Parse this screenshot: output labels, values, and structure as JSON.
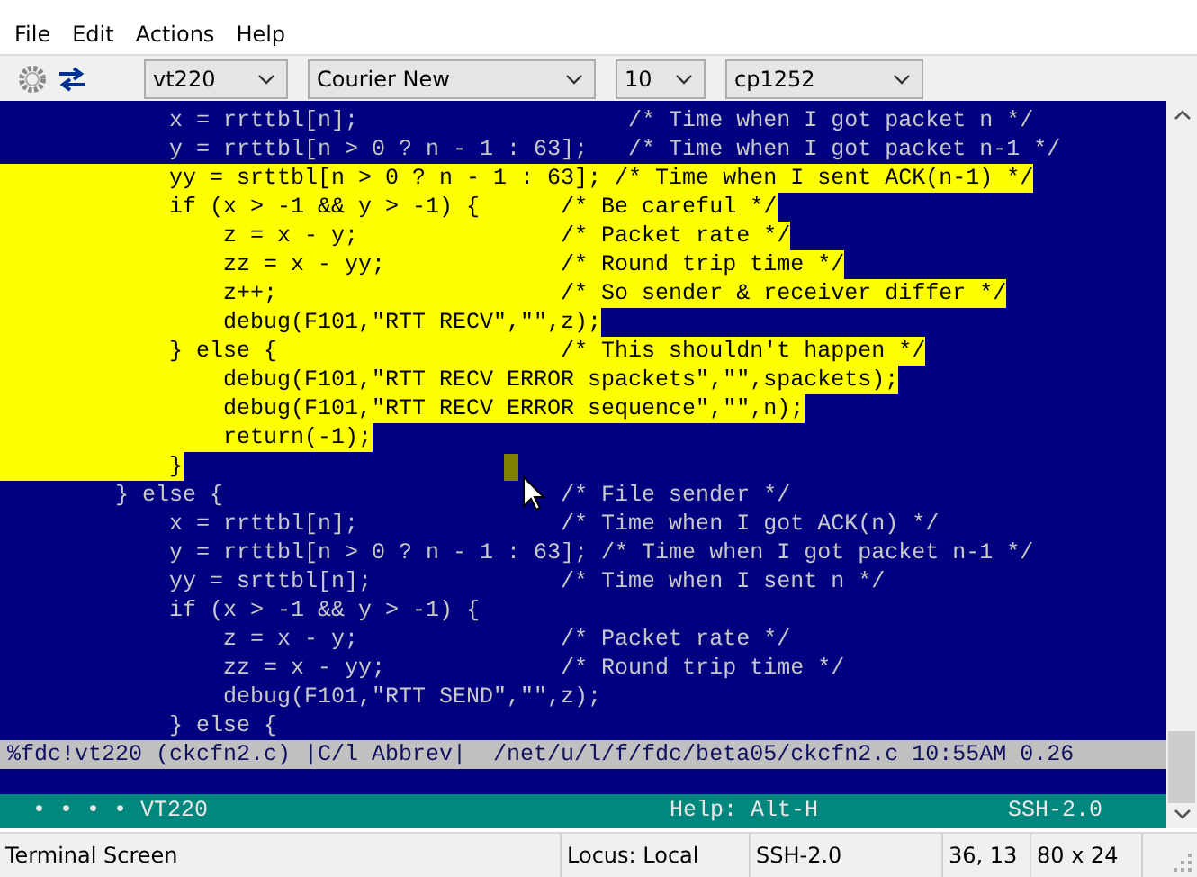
{
  "menu": [
    "File",
    "Edit",
    "Actions",
    "Help"
  ],
  "toolbar": {
    "terminal_type": "vt220",
    "font": "Courier New",
    "font_size": "10",
    "charset": "cp1252"
  },
  "terminal": {
    "lines": [
      {
        "text": "            x = rrttbl[n];                    /* Time when I got packet n */",
        "selected": false,
        "cursor": false
      },
      {
        "text": "            y = rrttbl[n > 0 ? n - 1 : 63];   /* Time when I got packet n-1 */",
        "selected": false,
        "cursor": false
      },
      {
        "text": "            yy = srttbl[n > 0 ? n - 1 : 63]; /* Time when I sent ACK(n-1) */",
        "selected": true,
        "cursor": false
      },
      {
        "text": "            if (x > -1 && y > -1) {      /* Be careful */",
        "selected": true,
        "cursor": false
      },
      {
        "text": "                z = x - y;               /* Packet rate */",
        "selected": true,
        "cursor": false
      },
      {
        "text": "                zz = x - yy;             /* Round trip time */",
        "selected": true,
        "cursor": false
      },
      {
        "text": "                z++;                     /* So sender & receiver differ */",
        "selected": true,
        "cursor": false
      },
      {
        "text": "                debug(F101,\"RTT RECV\",\"\",z);",
        "selected": true,
        "cursor": false
      },
      {
        "text": "            } else {                     /* This shouldn't happen */",
        "selected": true,
        "cursor": false
      },
      {
        "text": "                debug(F101,\"RTT RECV ERROR spackets\",\"\",spackets);",
        "selected": true,
        "cursor": false
      },
      {
        "text": "                debug(F101,\"RTT RECV ERROR sequence\",\"\",n);",
        "selected": true,
        "cursor": false
      },
      {
        "text": "                return(-1);",
        "selected": true,
        "cursor": false
      },
      {
        "text": "            }",
        "selected": true,
        "cursor": true
      },
      {
        "text": "        } else {",
        "comment": "/* File sender */",
        "selected": false,
        "cursor": false
      },
      {
        "text": "            x = rrttbl[n];               /* Time when I got ACK(n) */",
        "selected": false,
        "cursor": false
      },
      {
        "text": "            y = rrttbl[n > 0 ? n - 1 : 63]; /* Time when I got packet n-1 */",
        "selected": false,
        "cursor": false
      },
      {
        "text": "            yy = srttbl[n];              /* Time when I sent n */",
        "selected": false,
        "cursor": false
      },
      {
        "text": "            if (x > -1 && y > -1) {",
        "selected": false,
        "cursor": false
      },
      {
        "text": "                z = x - y;               /* Packet rate */",
        "selected": false,
        "cursor": false
      },
      {
        "text": "                zz = x - yy;             /* Round trip time */",
        "selected": false,
        "cursor": false
      },
      {
        "text": "                debug(F101,\"RTT SEND\",\"\",z);",
        "selected": false,
        "cursor": false
      },
      {
        "text": "            } else {",
        "selected": false,
        "cursor": false
      }
    ],
    "status_line": "%fdc!vt220 (ckcfn2.c) |C/l Abbrev|  /net/u/l/f/fdc/beta05/ckcfn2.c 10:55AM 0.26",
    "info_bar": {
      "indicator": "• • • • VT220",
      "help": "Help: Alt-H",
      "protocol": "SSH-2.0"
    }
  },
  "status_bar": [
    "Terminal Screen",
    "Locus: Local",
    "SSH-2.0",
    "36, 13",
    "80 x 24"
  ]
}
